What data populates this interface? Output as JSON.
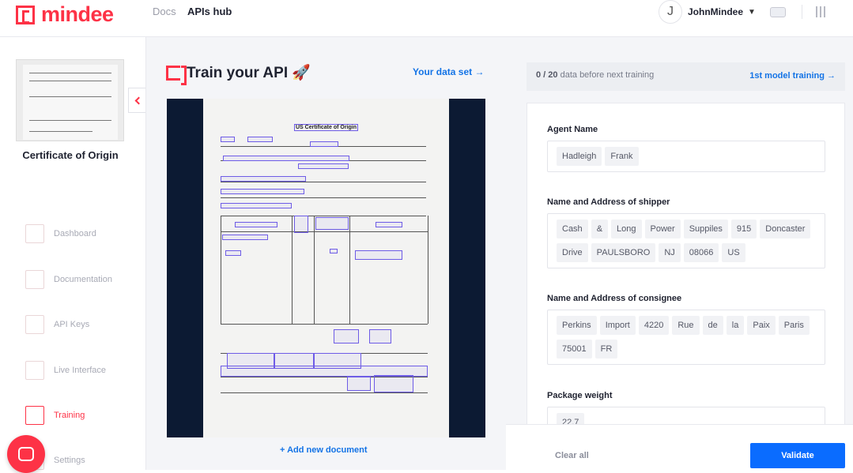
{
  "header": {
    "brand": "mindee",
    "nav": [
      {
        "label": "Docs"
      },
      {
        "label": "APIs hub"
      }
    ],
    "user": {
      "initial": "J",
      "name": "JohnMindee"
    }
  },
  "sidebar": {
    "project_title": "Certificate of Origin",
    "menu": [
      {
        "label": "Dashboard",
        "icon": "dashboard-icon"
      },
      {
        "label": "Documentation",
        "icon": "documentation-icon"
      },
      {
        "label": "API Keys",
        "icon": "lock-icon"
      },
      {
        "label": "Live Interface",
        "icon": "live-interface-icon"
      },
      {
        "label": "Training",
        "icon": "training-icon",
        "active": true
      },
      {
        "label": "Settings",
        "icon": "settings-icon"
      }
    ]
  },
  "center": {
    "title": "Train your API 🚀",
    "dataset_link": "Your data set →",
    "document_heading": "US Certificate of Origin",
    "add_document": "+ Add new document"
  },
  "right": {
    "progress": {
      "current": "0",
      "total": "20",
      "separator": " / ",
      "text": " data before next training"
    },
    "model_link": "1st model training →",
    "fields": [
      {
        "label": "Agent Name",
        "values": [
          "Hadleigh",
          "Frank"
        ]
      },
      {
        "label": "Name and Address of shipper",
        "values": [
          "Cash",
          "&",
          "Long",
          "Power",
          "Suppiles",
          "915",
          "Doncaster",
          "Drive",
          "PAULSBORO",
          "NJ",
          "08066",
          "US"
        ]
      },
      {
        "label": "Name and Address of consignee",
        "values": [
          "Perkins",
          "Import",
          "4220",
          "Rue",
          "de",
          "la",
          "Paix",
          "Paris",
          "75001",
          "FR"
        ]
      },
      {
        "label": "Package weight",
        "values": [
          "22.7"
        ]
      }
    ],
    "clear_all": "Clear all",
    "validate": "Validate"
  },
  "colors": {
    "brand": "#fd3246",
    "link": "#1373e6",
    "primary_button": "#0a6cff"
  }
}
